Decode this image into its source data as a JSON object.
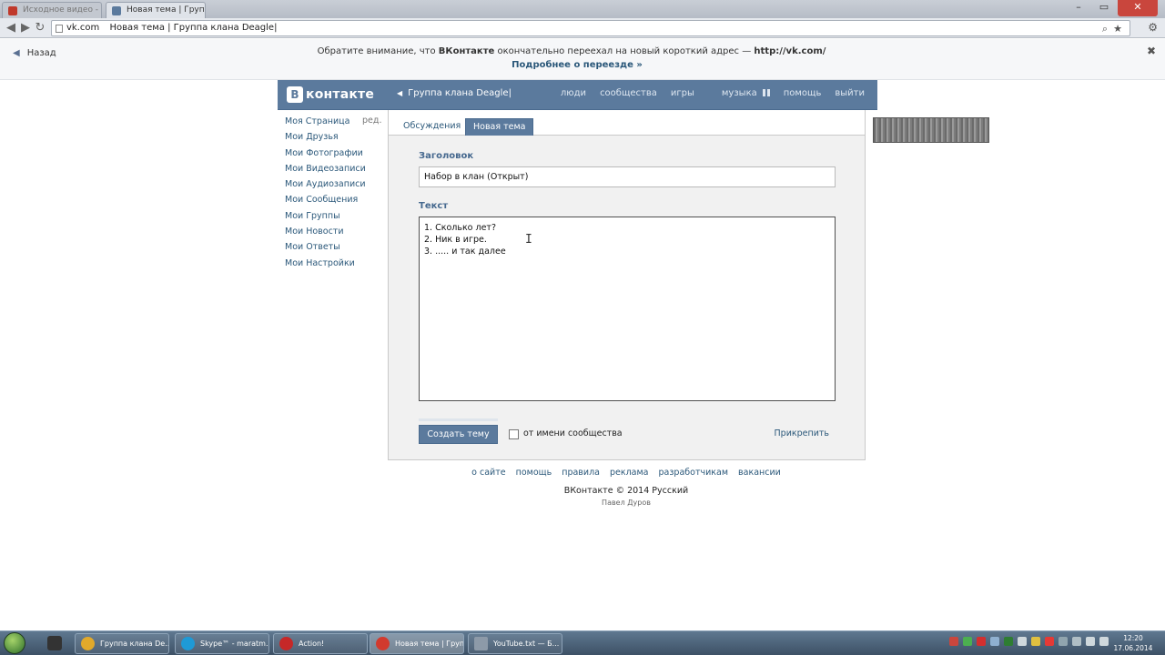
{
  "browser": {
    "tabs": [
      {
        "label": "Исходное видео - Y..."
      },
      {
        "label": "Новая тема | Групп..."
      }
    ],
    "url_domain": "vk.com",
    "url_text": "Новая тема | Группа клана Deagle|"
  },
  "notice": {
    "back_label": "Назад",
    "text_pre": "Обратите внимание, что ",
    "text_brand": "ВКонтакте",
    "text_mid": " окончательно переехал на новый короткий адрес — ",
    "text_url": "http://vk.com/",
    "more_label": "Подробнее о переезде »"
  },
  "header": {
    "logo_letter": "B",
    "logo_text": "контакте",
    "breadcrumb": "Группа клана Deagle|",
    "nav": {
      "people": "люди",
      "communities": "сообщества",
      "games": "игры",
      "music": "музыка",
      "help": "помощь",
      "logout": "выйти"
    }
  },
  "menu": {
    "edit_label": "ред.",
    "items": [
      "Моя Страница",
      "Мои Друзья",
      "Мои Фотографии",
      "Мои Видеозаписи",
      "Мои Аудиозаписи",
      "Мои Сообщения",
      "Мои Группы",
      "Мои Новости",
      "Мои Ответы",
      "Мои Настройки"
    ]
  },
  "page": {
    "tabs": {
      "discussions": "Обсуждения",
      "new_topic": "Новая тема"
    },
    "title_label": "Заголовок",
    "title_value": "Набор в клан (Открыт)",
    "text_label": "Текст",
    "text_value": "1. Сколько лет?\n2. Ник в игре.\n3. ..... и так далее",
    "create_label": "Создать тему",
    "community_label": "от имени сообщества",
    "attach_label": "Прикрепить"
  },
  "footer": {
    "links": [
      "о сайте",
      "помощь",
      "правила",
      "реклама",
      "разработчикам",
      "вакансии"
    ],
    "copyright": "ВКонтакте © 2014  Русский",
    "author": "Павел Дуров"
  },
  "taskbar": {
    "items": [
      {
        "label": "Группа клана De..."
      },
      {
        "label": "Skype™ - maratm..."
      },
      {
        "label": "Action!"
      },
      {
        "label": "Новая тема | Груп..."
      },
      {
        "label": "YouTube.txt — Б..."
      }
    ],
    "time": "12:20",
    "date": "17.06.2014"
  },
  "colors": {
    "vk_blue": "#5b7a9d",
    "link": "#2b587a",
    "label": "#45688e"
  }
}
